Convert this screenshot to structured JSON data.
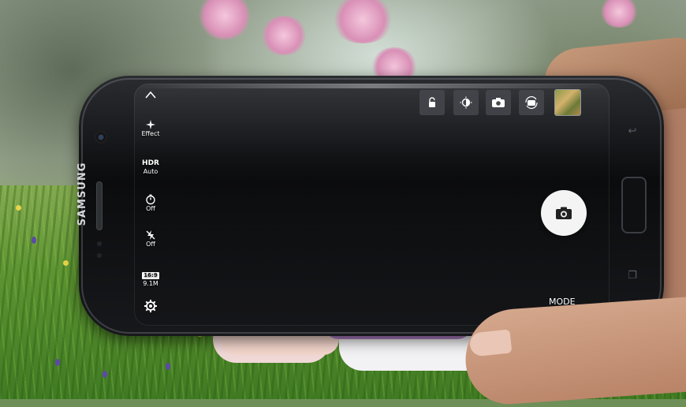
{
  "brand": "SAMSUNG",
  "camera": {
    "left_bar": {
      "collapse_icon": "chevron-up-icon",
      "effect": {
        "icon": "effect-sparkle-icon",
        "label": "Effect"
      },
      "hdr": {
        "title": "HDR",
        "value": "Auto"
      },
      "timer": {
        "icon": "timer-icon",
        "value": "Off"
      },
      "flash": {
        "icon": "flash-off-icon",
        "value": "Off"
      },
      "picture_size": {
        "ratio": "16:9",
        "megapixels": "9.1M"
      },
      "settings_icon": "gear-icon"
    },
    "top_bar": {
      "icons": [
        "lock-icon",
        "brightness-icon",
        "camera-switch-icon",
        "rotate-camera-icon"
      ]
    },
    "shutter_icon": "camera-icon",
    "mode_label": "MODE"
  },
  "colors": {
    "phone_body": "#0b0c0e",
    "toolbar_button": "#46484e",
    "shutter": "#f4f4f4",
    "ui_text": "#ffffff"
  }
}
